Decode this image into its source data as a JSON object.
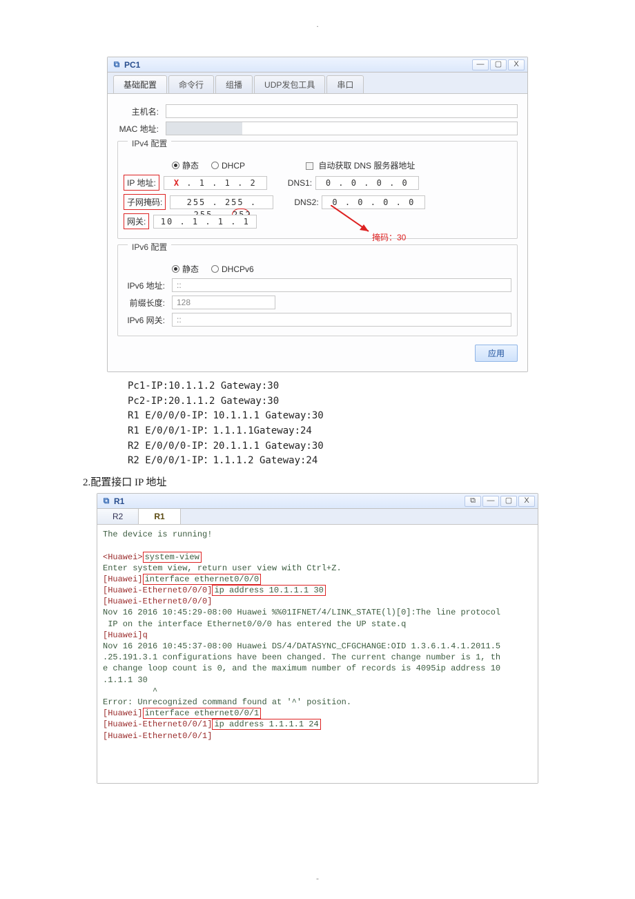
{
  "pc1": {
    "title": "PC1",
    "tabs": [
      "基础配置",
      "命令行",
      "组播",
      "UDP发包工具",
      "串口"
    ],
    "host_label": "主机名:",
    "mac_label": "MAC 地址:",
    "ipv4_legend": "IPv4 配置",
    "static_label": "静态",
    "dhcp_label": "DHCP",
    "auto_dns_label": "自动获取 DNS 服务器地址",
    "ip_label": "IP 地址:",
    "ip_value_prefix": "X",
    "ip_value_rest": " . 1 . 1 . 2",
    "dns1_label": "DNS1:",
    "dns1_val": "0 . 0 . 0 . 0",
    "mask_label": "子网掩码:",
    "mask_val_main": "255 . 255 . 255 .",
    "mask_val_last": "252",
    "dns2_label": "DNS2:",
    "dns2_val": "0 . 0 . 0 . 0",
    "gw_label": "网关:",
    "gw_val": "10 . 1 . 1 . 1",
    "annotation": "掩码：30",
    "ipv6_legend": "IPv6 配置",
    "dhcpv6_label": "DHCPv6",
    "ip6_label": "IPv6 地址:",
    "ip6_val": "::",
    "plen_label": "前缀长度:",
    "plen_val": "128",
    "ip6gw_label": "IPv6 网关:",
    "ip6gw_val": "::",
    "apply": "应用"
  },
  "mid": {
    "l1": "Pc1-IP:10.1.1.2  Gateway:30",
    "l2": "Pc2-IP:20.1.1.2  Gateway:30",
    "l3": "R1 E/0/0/0-IP：10.1.1.1 Gateway:30",
    "l4": "R1 E/0/0/1-IP：1.1.1.1Gateway:24",
    "l5": "R2 E/0/0/0-IP：20.1.1.1 Gateway:30",
    "l6": "R2 E/0/0/1-IP：1.1.1.2  Gateway:24"
  },
  "heading": "2.配置接口 IP 地址",
  "r1": {
    "title": "R1",
    "tabs": {
      "inactive": "R2",
      "active": "R1"
    },
    "c": {
      "run": "The device is running!",
      "p1": "<Huawei>",
      "cmd1": "system-view",
      "l2": "Enter system view, return user view with Ctrl+Z.",
      "p2": "[Huawei]",
      "cmd2": "interface ethernet0/0/0",
      "p3": "[Huawei-Ethernet0/0/0]",
      "cmd3": "ip address 10.1.1.1 30",
      "p3b": "[Huawei-Ethernet0/0/0]",
      "log1": "Nov 16 2016 10:45:29-08:00 Huawei %%01IFNET/4/LINK_STATE(l)[0]:The line protocol\n IP on the interface Ethernet0/0/0 has entered the UP state.q",
      "p4": "[Huawei]q",
      "log2": "Nov 16 2016 10:45:37-08:00 Huawei DS/4/DATASYNC_CFGCHANGE:OID 1.3.6.1.4.1.2011.5\n.25.191.3.1 configurations have been changed. The current change number is 1, th\ne change loop count is 0, and the maximum number of records is 4095ip address 10\n.1.1.1 30",
      "caret": "          ^",
      "err": "Error: Unrecognized command found at '^' position.",
      "p5": "[Huawei]",
      "cmd4": "interface ethernet0/0/1",
      "p6": "[Huawei-Ethernet0/0/1]",
      "cmd5": "ip address 1.1.1.1 24",
      "p7": "[Huawei-Ethernet0/0/1]"
    }
  },
  "page_dot": "."
}
